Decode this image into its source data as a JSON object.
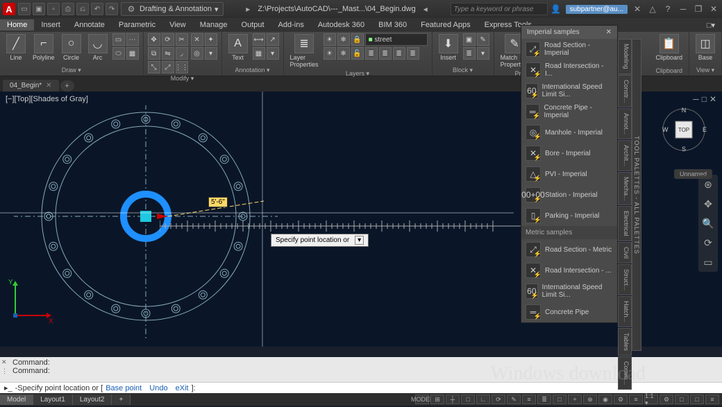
{
  "title": {
    "logo": "A",
    "workspace": "Drafting & Annotation",
    "doc_path": "Z:\\Projects\\AutoCAD\\---_Mast...\\04_Begin.dwg",
    "search_placeholder": "Type a keyword or phrase",
    "user": "subpartner@au...",
    "doc_name": "04_Begin*"
  },
  "menutabs": [
    "Home",
    "Insert",
    "Annotate",
    "Parametric",
    "View",
    "Manage",
    "Output",
    "Add-ins",
    "Autodesk 360",
    "BIM 360",
    "Featured Apps",
    "Express Tools"
  ],
  "ribbon": {
    "draw": {
      "label": "Draw ▾",
      "items": [
        "Line",
        "Polyline",
        "Circle",
        "Arc"
      ]
    },
    "modify": {
      "label": "Modify ▾"
    },
    "annotation": {
      "label": "Annotation ▾",
      "text": "Text"
    },
    "layers": {
      "label": "Layers ▾",
      "props": "Layer\nProperties",
      "current": "street"
    },
    "block": {
      "label": "Block ▾",
      "insert": "Insert"
    },
    "properties": {
      "label": "Properties",
      "match": "Match\nProperties"
    },
    "clipboard": {
      "label": "Clipboard"
    },
    "base": {
      "label": "Base"
    },
    "view": {
      "label": "View ▾"
    }
  },
  "viewport": {
    "label": "[−][Top][Shades of Gray]",
    "measure": "5'-6\"",
    "tooltip": "Specify point location or",
    "viewcube_label": "TOP",
    "viewcube_under": "Unnamed",
    "compass": {
      "n": "N",
      "e": "E",
      "s": "S",
      "w": "W"
    }
  },
  "palette": {
    "title": "Imperial samples",
    "bar_title": "TOOL PALETTES - ALL PALETTES",
    "sidetabs": [
      "Modeling",
      "Constr...",
      "Annot...",
      "Archit...",
      "Mecha...",
      "Electrical",
      "Civil",
      "Struct...",
      "Hatch...",
      "Tables",
      "Comm..."
    ],
    "sections": [
      {
        "header": null,
        "items": [
          {
            "icon": "road",
            "label": "Road Section - Imperial"
          },
          {
            "icon": "road-x",
            "label": "Road Intersection - I..."
          },
          {
            "icon": "60",
            "label": "International Speed Limit Si..."
          },
          {
            "icon": "pipe",
            "label": "Concrete Pipe - Imperial"
          },
          {
            "icon": "manhole",
            "label": "Manhole - Imperial"
          },
          {
            "icon": "bore",
            "label": "Bore - Imperial"
          },
          {
            "icon": "pvi",
            "label": "PVI - Imperial"
          },
          {
            "icon": "station",
            "label": "Station - Imperial"
          },
          {
            "icon": "parking",
            "label": "Parking - Imperial"
          }
        ]
      },
      {
        "header": "Metric samples",
        "items": [
          {
            "icon": "road",
            "label": "Road Section - Metric"
          },
          {
            "icon": "road-x",
            "label": "Road Intersection - ..."
          },
          {
            "icon": "60",
            "label": "International Speed Limit Si..."
          },
          {
            "icon": "pipe",
            "label": "Concrete Pipe"
          }
        ]
      }
    ]
  },
  "command": {
    "hist": [
      "Command:",
      "Command:"
    ],
    "prompt_prefix": "-Specify point location or [",
    "opt1": "Base point",
    "opt2": "Undo",
    "opt3": "eXit",
    "prompt_suffix": "]:"
  },
  "status": {
    "tabs": [
      "Model",
      "Layout1",
      "Layout2"
    ],
    "icons": [
      "MODEL",
      "⊞",
      "┼",
      "□",
      "∟",
      "⟳",
      "✎",
      "≡",
      "≣",
      "□",
      "+",
      "⊕",
      "◉",
      "⚙",
      "≡",
      "1:1 ▾",
      "⚙",
      "□",
      "□",
      "≡"
    ]
  },
  "watermark": "Windows   download"
}
